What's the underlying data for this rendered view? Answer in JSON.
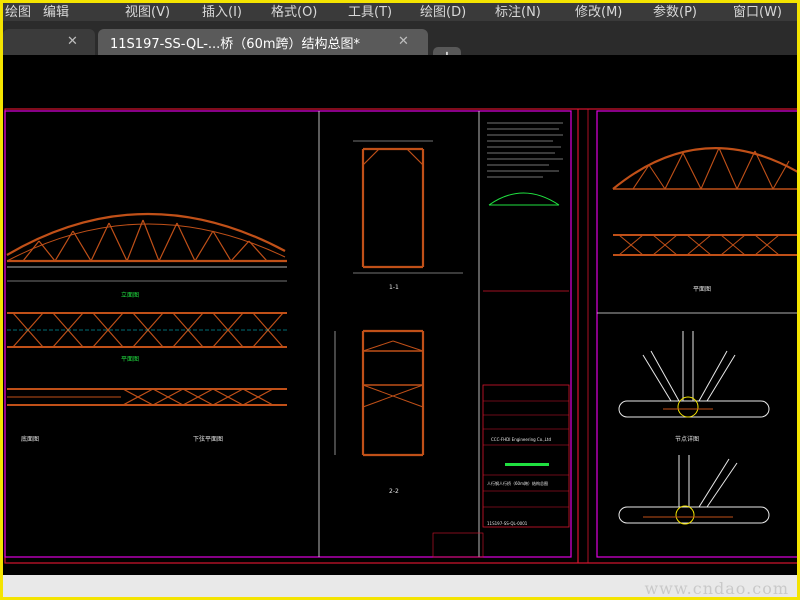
{
  "menu": {
    "items": [
      "绘图",
      "编辑",
      "视图(V)",
      "插入(I)",
      "格式(O)",
      "工具(T)",
      "绘图(D)",
      "标注(N)",
      "修改(M)",
      "参数(P)",
      "窗口(W)"
    ]
  },
  "tabs": {
    "active_label": "11S197-SS-QL-...桥（60m跨）结构总图*",
    "close_symbol": "✕",
    "add_symbol": "+"
  },
  "drawing": {
    "company": "CCC-FHDI Engineering Co.,Ltd",
    "title_block_title": "人行钢人行桥（60m跨）结构总图",
    "drawing_number": "11S197-SS-QL-0001",
    "section_labels": [
      "立面图",
      "平面图",
      "底面图",
      "下弦平面图",
      "1-1",
      "2-2",
      "节点详图"
    ]
  },
  "colors": {
    "frame_border": "#f4e400",
    "menubar": "#3a3a3a",
    "tabbar": "#2b2b2b",
    "active_tab": "#5a5a5a",
    "canvas": "#000000",
    "border_red": "#d6152e",
    "border_magenta": "#e000e0",
    "steel": "#c05018",
    "cyan": "#00d8e8",
    "green": "#20e040"
  },
  "watermark": "www.cndao.com"
}
